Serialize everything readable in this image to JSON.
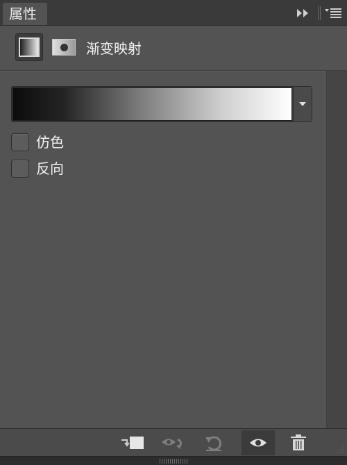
{
  "panel": {
    "tab_label": "属性",
    "collapse_icon": "double-chevron-right-icon",
    "menu_icon": "panel-menu-icon"
  },
  "header": {
    "adjustment_icon": "gradient-map-adjustment-icon",
    "mask_icon": "layer-mask-icon",
    "title": "渐变映射"
  },
  "gradient": {
    "start_color": "#0c0c0c",
    "end_color": "#ffffff",
    "dropdown_icon": "chevron-down-icon"
  },
  "options": [
    {
      "label": "仿色",
      "checked": false
    },
    {
      "label": "反向",
      "checked": false
    }
  ],
  "bottom_toolbar": {
    "buttons": [
      {
        "name": "clip-to-layer-icon",
        "state": "enabled"
      },
      {
        "name": "view-previous-state-icon",
        "state": "disabled"
      },
      {
        "name": "reset-icon",
        "state": "disabled"
      },
      {
        "name": "toggle-visibility-icon",
        "state": "active"
      },
      {
        "name": "trash-icon",
        "state": "enabled"
      }
    ]
  }
}
